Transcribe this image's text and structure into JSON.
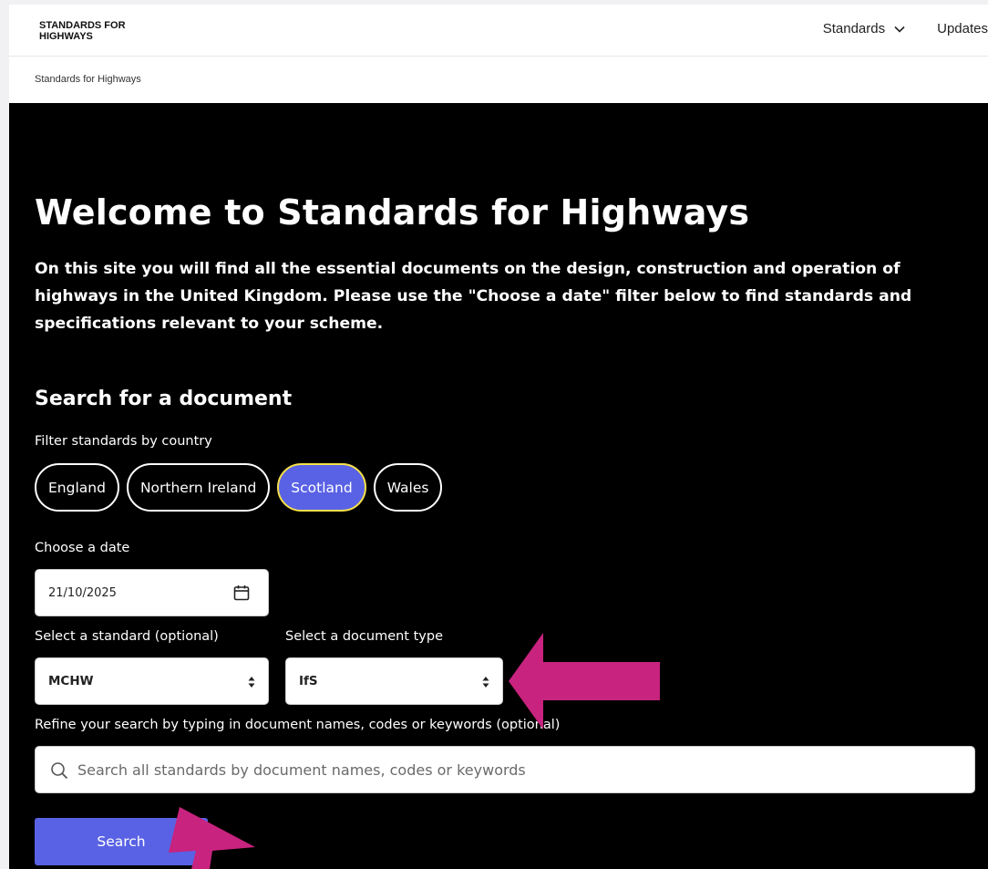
{
  "header": {
    "logo_text": "STANDARDS FOR HIGHWAYS",
    "nav": {
      "standards_label": "Standards",
      "updates_label": "Updates"
    }
  },
  "breadcrumb": "Standards for Highways",
  "hero": {
    "title": "Welcome to Standards for Highways",
    "intro": "On this site you will find all the essential documents on the design, construction and operation of highways in the United Kingdom. Please use the \"Choose a date\" filter below to find standards and specifications relevant to your scheme."
  },
  "search": {
    "heading": "Search for a document",
    "country_label": "Filter standards by country",
    "countries": [
      "England",
      "Northern Ireland",
      "Scotland",
      "Wales"
    ],
    "selected_country": "Scotland",
    "date_label": "Choose a date",
    "date_value": "21/10/2025",
    "standard_label": "Select a standard (optional)",
    "standard_value": "MCHW",
    "doctype_label": "Select a document type",
    "doctype_value": "IfS",
    "refine_label": "Refine your search by typing in document names, codes or keywords (optional)",
    "search_placeholder": "Search all standards by document names, codes or keywords",
    "search_button": "Search"
  },
  "colors": {
    "accent": "#5962e4",
    "active_border": "#f5e04a",
    "annotation_arrow": "#c8237e",
    "hero_background": "#000000"
  },
  "icons": {
    "nav_chevron": "chevron-down-icon",
    "date": "calendar-icon",
    "select": "select-updown-icon",
    "search": "search-icon"
  }
}
